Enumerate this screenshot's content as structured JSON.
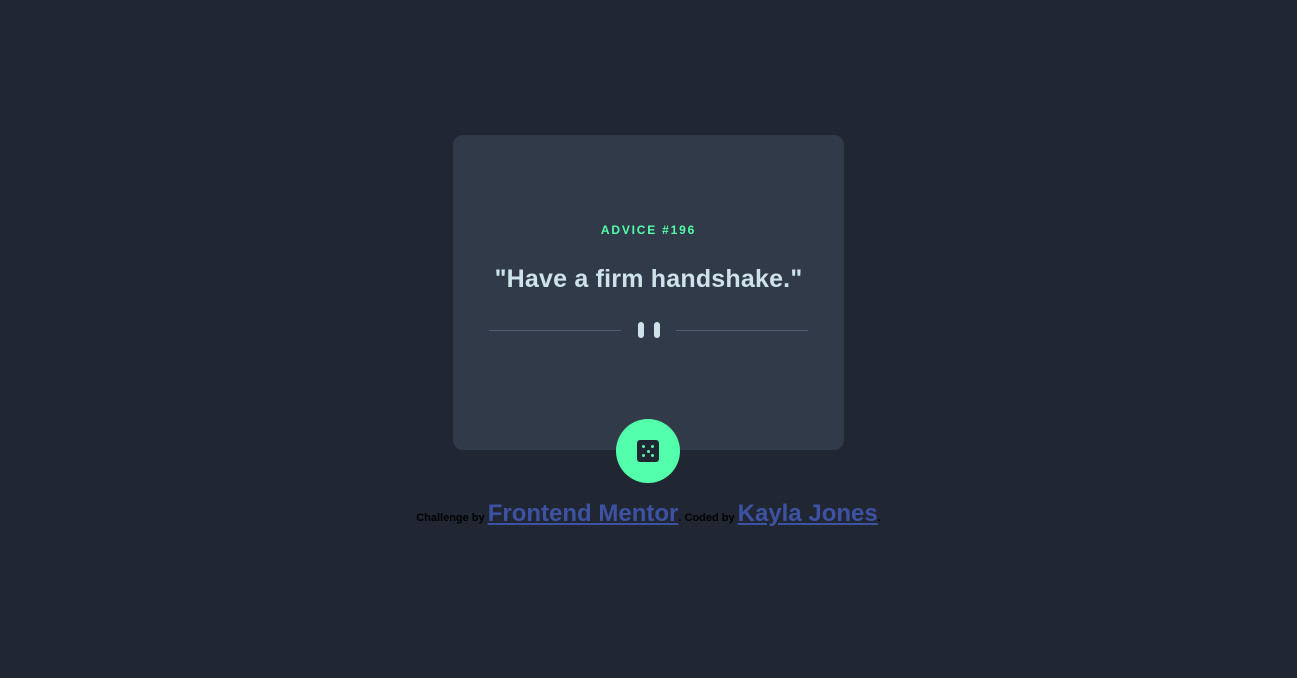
{
  "card": {
    "advice_id": "ADVICE #196",
    "advice_text": "\"Have a firm handshake.\""
  },
  "dice_button": {
    "icon": "dice-icon"
  },
  "divider": {
    "icon": "pause-icon"
  },
  "attribution": {
    "challenge_by": "Challenge by",
    "challenge_link": "Frontend Mentor",
    "coded_by": ". Coded by",
    "author_link": "Kayla Jones",
    "end": "."
  },
  "colors": {
    "background": "#202632",
    "card": "#313a48",
    "accent": "#53ffaa",
    "text": "#cee3e9",
    "divider": "#4f5d74",
    "link": "#3e52a3"
  }
}
